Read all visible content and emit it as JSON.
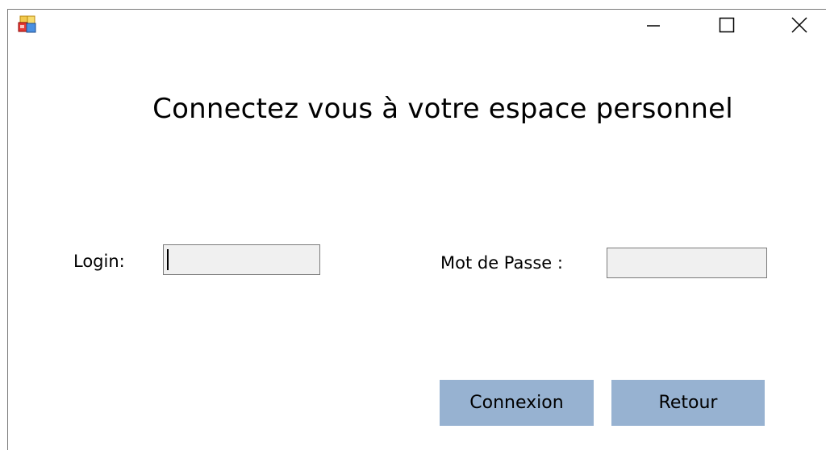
{
  "window": {
    "icon": "app-icon",
    "controls": {
      "minimize": "minimize-icon",
      "maximize": "maximize-icon",
      "close": "close-icon"
    }
  },
  "form": {
    "title": "Connectez vous à votre espace personnel",
    "login_label": "Login:",
    "login_value": "",
    "password_label": "Mot de Passe :",
    "password_value": ""
  },
  "buttons": {
    "connexion": "Connexion",
    "retour": "Retour"
  },
  "colors": {
    "button_bg": "#97b2d1",
    "field_bg": "#f0f0f0",
    "field_border": "#7a7a7a"
  }
}
